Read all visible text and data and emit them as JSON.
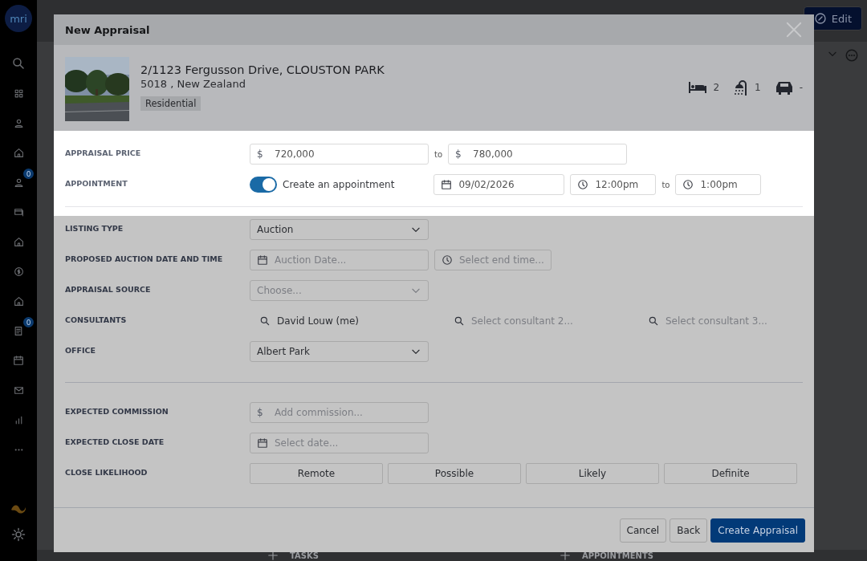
{
  "background": {
    "buttons": [
      {
        "label": "Edit",
        "kind": "primary"
      }
    ],
    "sections": [
      "TASKS",
      "APPOINTMENTS"
    ]
  },
  "sidebar": {
    "logo": "mri",
    "badges": [
      "0",
      "0"
    ]
  },
  "dialog": {
    "title": "New Appraisal",
    "property": {
      "address": "2/1123 Fergusson Drive, CLOUSTON PARK",
      "locality": "5018 , New Zealand",
      "tag": "Residential",
      "features": [
        {
          "kind": "bed",
          "count": "2"
        },
        {
          "kind": "bath",
          "count": "1"
        },
        {
          "kind": "car",
          "count": "-"
        }
      ]
    },
    "highlighted_rows": [
      {
        "label": "APPRAISAL PRICE",
        "kind": "range",
        "from": {
          "prefix": "$",
          "value": "720,000"
        },
        "separator": "to",
        "to": {
          "prefix": "$",
          "value": "780,000"
        }
      },
      {
        "label": "APPOINTMENT",
        "kind": "appointment",
        "on": true,
        "toggle_label": "Create an appointment",
        "date": "09/02/2026",
        "start": "12:00pm",
        "separator": "to",
        "end": "1:00pm"
      }
    ],
    "rows": [
      {
        "label": "LISTING TYPE",
        "kind": "select",
        "value": "Auction"
      },
      {
        "label": "PROPOSED AUCTION DATE AND TIME",
        "kind": "date_time",
        "date_placeholder": "Auction Date...",
        "time_placeholder": "Select end time..."
      },
      {
        "label": "APPRAISAL SOURCE",
        "kind": "select",
        "placeholder": "Choose..."
      },
      {
        "label": "CONSULTANTS",
        "kind": "consultants",
        "items": [
          {
            "value": "David Louw (me)"
          },
          {
            "placeholder": "Select consultant 2..."
          },
          {
            "placeholder": "Select consultant 3..."
          }
        ]
      },
      {
        "label": "OFFICE",
        "kind": "select",
        "value": "Albert Park"
      },
      {
        "kind": "divider"
      },
      {
        "label": "EXPECTED COMMISSION",
        "kind": "money",
        "prefix": "$",
        "placeholder": "Add commission..."
      },
      {
        "label": "EXPECTED CLOSE DATE",
        "kind": "date",
        "placeholder": "Select date..."
      },
      {
        "label": "CLOSE LIKELIHOOD",
        "kind": "choice",
        "options": [
          {
            "label": "Remote",
            "selected": false
          },
          {
            "label": "Possible",
            "selected": false
          },
          {
            "label": "Likely",
            "selected": false
          },
          {
            "label": "Definite",
            "selected": false
          }
        ]
      }
    ],
    "buttons": [
      {
        "label": "Cancel",
        "kind": "secondary"
      },
      {
        "label": "Back",
        "kind": "secondary"
      },
      {
        "label": "Create Appraisal",
        "kind": "primary"
      }
    ]
  }
}
